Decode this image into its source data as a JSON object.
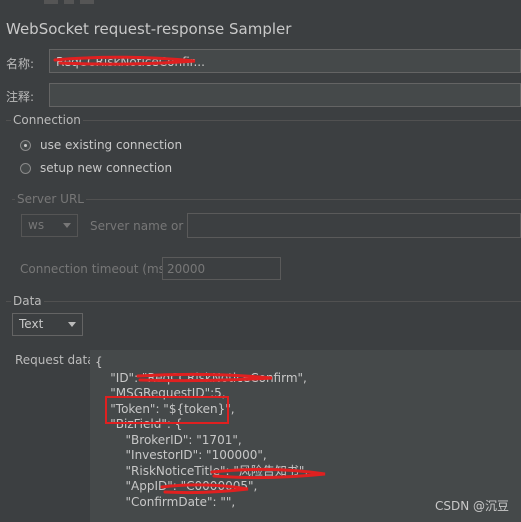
{
  "window": {
    "title": "WebSocket request-response Sampler"
  },
  "form": {
    "name_label": "名称:",
    "name_value": "ReqCCRiskNoticeConfir...",
    "comment_label": "注释:"
  },
  "connection": {
    "legend": "Connection",
    "options": [
      {
        "label": "use existing connection",
        "selected": true
      },
      {
        "label": "setup new connection",
        "selected": false
      }
    ]
  },
  "server_url": {
    "legend": "Server URL",
    "protocol": "ws",
    "host_label": "Server name or IP:",
    "timeout_label": "Connection timeout (ms):",
    "timeout_value": "20000"
  },
  "data": {
    "legend": "Data",
    "type": "Text",
    "request_label": "Request data:",
    "lines": [
      "{",
      "    \"ID\": \"ReqCCRiskNoticeConfirm\",",
      "    \"MSGRequestID\":5,",
      "    \"Token\": \"${token}\",",
      "    \"BizField\": {",
      "        \"BrokerID\": \"1701\",",
      "        \"InvestorID\": \"100000\",",
      "        \"RiskNoticeTitle\": \"风险告知书\",",
      "        \"AppID\": \"C0000005\",",
      "        \"ConfirmDate\": \"\","
    ]
  },
  "watermark": "CSDN @沉豆",
  "colors": {
    "background": "#3c3f41",
    "field": "#45494a",
    "annotation_red": "#e02020"
  }
}
